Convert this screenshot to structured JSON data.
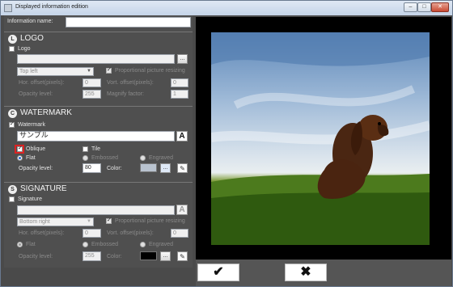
{
  "window": {
    "title": "Displayed information edition",
    "min": "–",
    "max": "□",
    "close": "✕"
  },
  "info_name": {
    "label": "Information name:",
    "value": ""
  },
  "logo": {
    "title": "LOGO",
    "icon": "L",
    "checkbox_label": "Logo",
    "path_value": "",
    "browse": "...",
    "position": "Top left",
    "proportional_label": "Proportional picture resizing",
    "hor_label": "Hor. offset(pixels):",
    "hor_value": "0",
    "vert_label": "Vort. offset(pixels):",
    "vert_value": "0",
    "opacity_label": "Opacity level:",
    "opacity_value": "255",
    "magnify_label": "Magnify factor:",
    "magnify_value": "1"
  },
  "watermark": {
    "title": "WATERMARK",
    "icon": "C",
    "checkbox_label": "Watermark",
    "text_value": "サンプル",
    "font_button": "A",
    "oblique_label": "Oblique",
    "tile_label": "Tile",
    "flat_label": "Flat",
    "embossed_label": "Embossed",
    "engraved_label": "Engraved",
    "opacity_label": "Opacity level:",
    "opacity_value": "80",
    "color_label": "Color:",
    "color_value": "#b9c3cf",
    "color_button": "...",
    "pencil": "✎"
  },
  "signature": {
    "title": "SIGNATURE",
    "icon": "S",
    "checkbox_label": "Signature",
    "text_value": "",
    "font_button": "A",
    "position": "Bottom right",
    "proportional_label": "Proportional picture resizing",
    "hor_label": "Hor. offset(pixels):",
    "hor_value": "0",
    "vert_label": "Vort. offset(pixels):",
    "vert_value": "0",
    "flat_label": "Flat",
    "embossed_label": "Embossed",
    "engraved_label": "Engraved",
    "opacity_label": "Opacity level:",
    "opacity_value": "255",
    "color_label": "Color:",
    "color_value": "#000000",
    "color_button": "...",
    "pencil": "✎"
  },
  "actions": {
    "ok": "✔",
    "cancel": "✖"
  },
  "icons": [
    "app-icon",
    "minimize-icon",
    "maximize-icon",
    "close-icon",
    "checkmark-icon",
    "cross-icon",
    "pencil-icon",
    "font-icon"
  ]
}
